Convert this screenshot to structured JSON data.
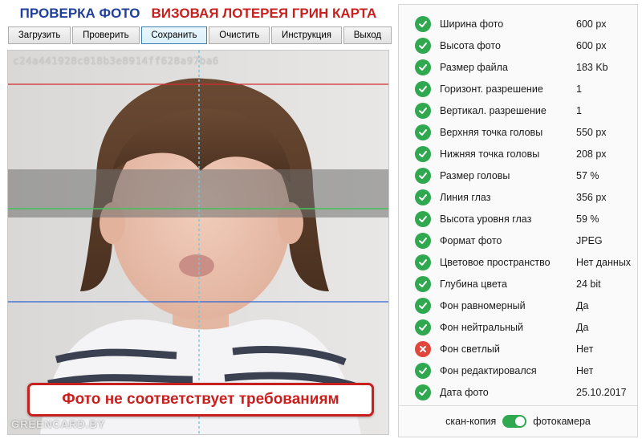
{
  "header": {
    "title_check": "ПРОВЕРКА ФОТО",
    "title_lottery": "ВИЗОВАЯ ЛОТЕРЕЯ ГРИН КАРТА"
  },
  "toolbar": {
    "buttons": [
      "Загрузить",
      "Проверить",
      "Сохранить",
      "Очистить",
      "Инструкция",
      "Выход"
    ],
    "active_index": 2
  },
  "photo": {
    "hash": "c24a441928c018b3e8914ff628a97ba6",
    "watermark": "GREENCARD.BY",
    "verdict": "Фото не соответствует требованиям"
  },
  "checks": [
    {
      "label": "Ширина фото",
      "value": "600 px",
      "status": "ok"
    },
    {
      "label": "Высота фото",
      "value": "600 px",
      "status": "ok"
    },
    {
      "label": "Размер файла",
      "value": "183 Kb",
      "status": "ok"
    },
    {
      "label": "Горизонт. разрешение",
      "value": "1",
      "status": "ok"
    },
    {
      "label": "Вертикал. разрешение",
      "value": "1",
      "status": "ok"
    },
    {
      "label": "Верхняя точка головы",
      "value": "550 px",
      "status": "ok"
    },
    {
      "label": "Нижняя точка головы",
      "value": "208 px",
      "status": "ok"
    },
    {
      "label": "Размер головы",
      "value": "57 %",
      "status": "ok"
    },
    {
      "label": "Линия глаз",
      "value": "356 px",
      "status": "ok"
    },
    {
      "label": "Высота уровня глаз",
      "value": "59 %",
      "status": "ok"
    },
    {
      "label": "Формат фото",
      "value": "JPEG",
      "status": "ok"
    },
    {
      "label": "Цветовое пространство",
      "value": "Нет данных",
      "status": "ok"
    },
    {
      "label": "Глубина цвета",
      "value": "24 bit",
      "status": "ok"
    },
    {
      "label": "Фон равномерный",
      "value": "Да",
      "status": "ok"
    },
    {
      "label": "Фон нейтральный",
      "value": "Да",
      "status": "ok"
    },
    {
      "label": "Фон светлый",
      "value": "Нет",
      "status": "bad"
    },
    {
      "label": "Фон редактировался",
      "value": "Нет",
      "status": "ok"
    },
    {
      "label": "Дата фото",
      "value": "25.10.2017",
      "status": "ok"
    }
  ],
  "footer": {
    "left_label": "скан-копия",
    "right_label": "фотокамера",
    "toggle_on": true
  },
  "colors": {
    "ok": "#2fa84f",
    "bad": "#e0463c",
    "title_blue": "#1f3f9a",
    "title_red": "#c8201e"
  }
}
